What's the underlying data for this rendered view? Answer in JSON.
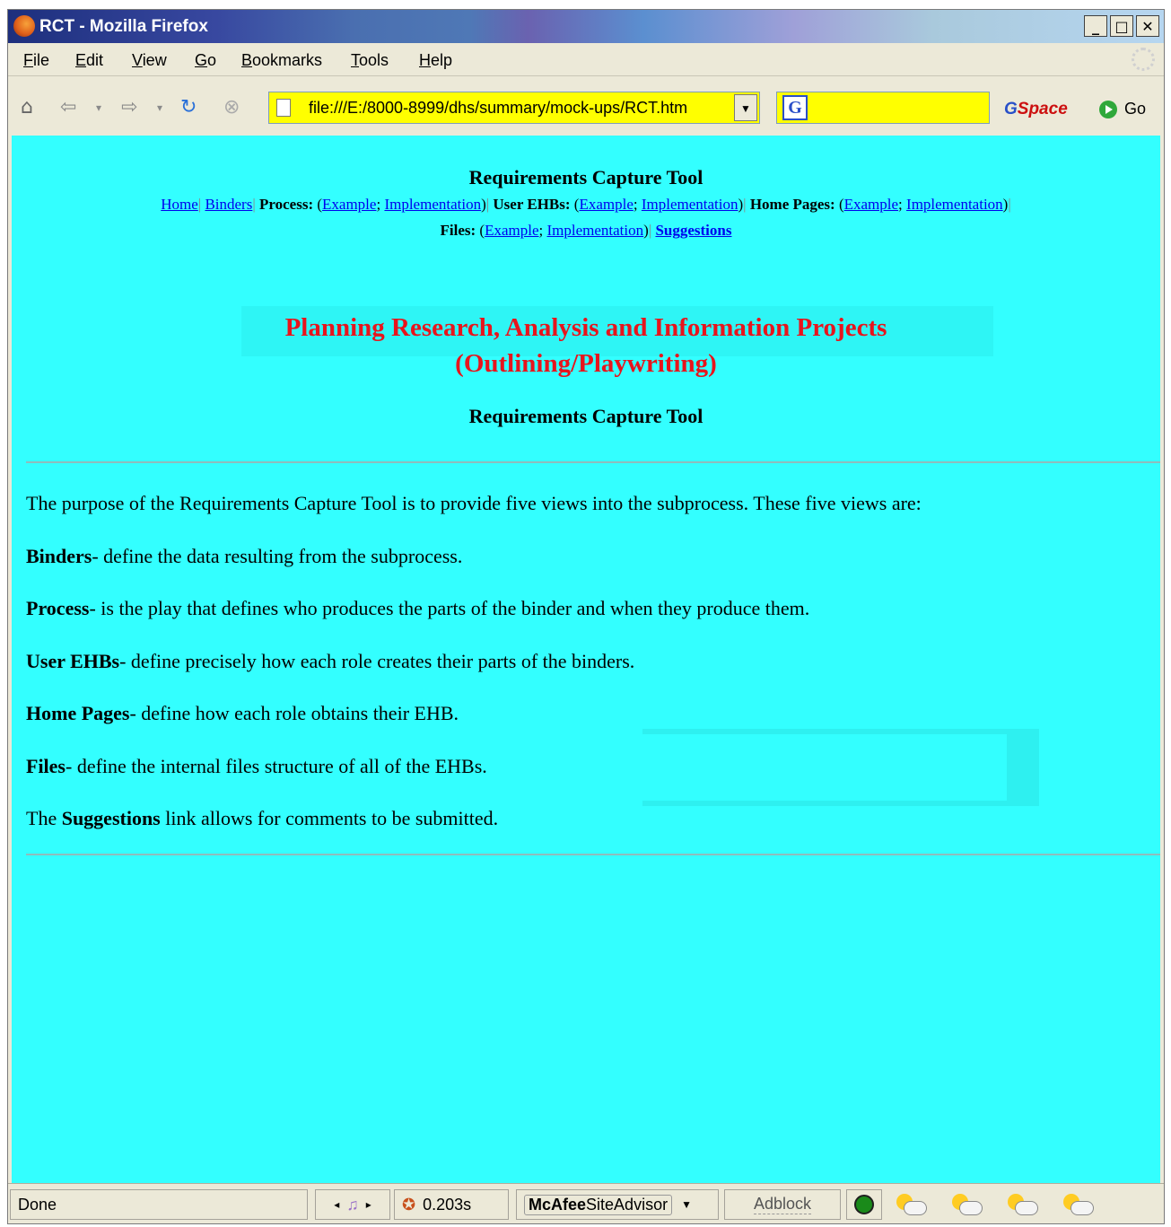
{
  "window": {
    "title": "RCT - Mozilla Firefox",
    "minimize": "_",
    "maximize": "□",
    "close": "✕"
  },
  "menu": [
    {
      "label": "File",
      "key": "F",
      "rest": "ile"
    },
    {
      "label": "Edit",
      "key": "E",
      "rest": "dit"
    },
    {
      "label": "View",
      "key": "V",
      "rest": "iew"
    },
    {
      "label": "Go",
      "key": "G",
      "rest": "o"
    },
    {
      "label": "Bookmarks",
      "key": "B",
      "rest": "ookmarks"
    },
    {
      "label": "Tools",
      "key": "T",
      "rest": "ools"
    },
    {
      "label": "Help",
      "key": "H",
      "rest": "elp"
    }
  ],
  "toolbar": {
    "url": "file:///E:/8000-8999/dhs/summary/mock-ups/RCT.htm",
    "search_value": "",
    "gspace_g": "G",
    "gspace_rest": "Space",
    "go_label": "Go"
  },
  "page": {
    "header_title": "Requirements Capture Tool",
    "nav": {
      "home": "Home",
      "binders": "Binders",
      "process_label": "Process:",
      "user_ehbs_label": "User EHBs:",
      "home_pages_label": "Home Pages:",
      "files_label": "Files:",
      "example": "Example",
      "implementation": "Implementation",
      "suggestions": "Suggestions"
    },
    "main_title_line1": "Planning Research, Analysis and Information Projects",
    "main_title_line2": "(Outlining/Playwriting)",
    "subheading": "Requirements Capture Tool",
    "intro": "The purpose of the Requirements Capture Tool is to provide five views into the subprocess. These five views are:",
    "items": [
      {
        "term": "Binders",
        "text": "- define the data resulting from the subprocess."
      },
      {
        "term": "Process",
        "text": "- is the play that defines who produces the parts of the binder and when they produce them."
      },
      {
        "term": "User EHBs",
        "text": "- define precisely how each role creates their parts of the binders."
      },
      {
        "term": "Home Pages",
        "text": "- define how each role obtains their EHB."
      },
      {
        "term": "Files",
        "text": "- define the internal files structure of all of the EHBs."
      }
    ],
    "suggestion_pre": "The",
    "suggestion_term": "Suggestions",
    "suggestion_post": "link allows for comments to be submitted."
  },
  "status": {
    "text": "Done",
    "timer": "0.203s",
    "siteadvisor_brand": "McAfee",
    "siteadvisor_rest": "SiteAdvisor",
    "adblock": "Adblock"
  }
}
